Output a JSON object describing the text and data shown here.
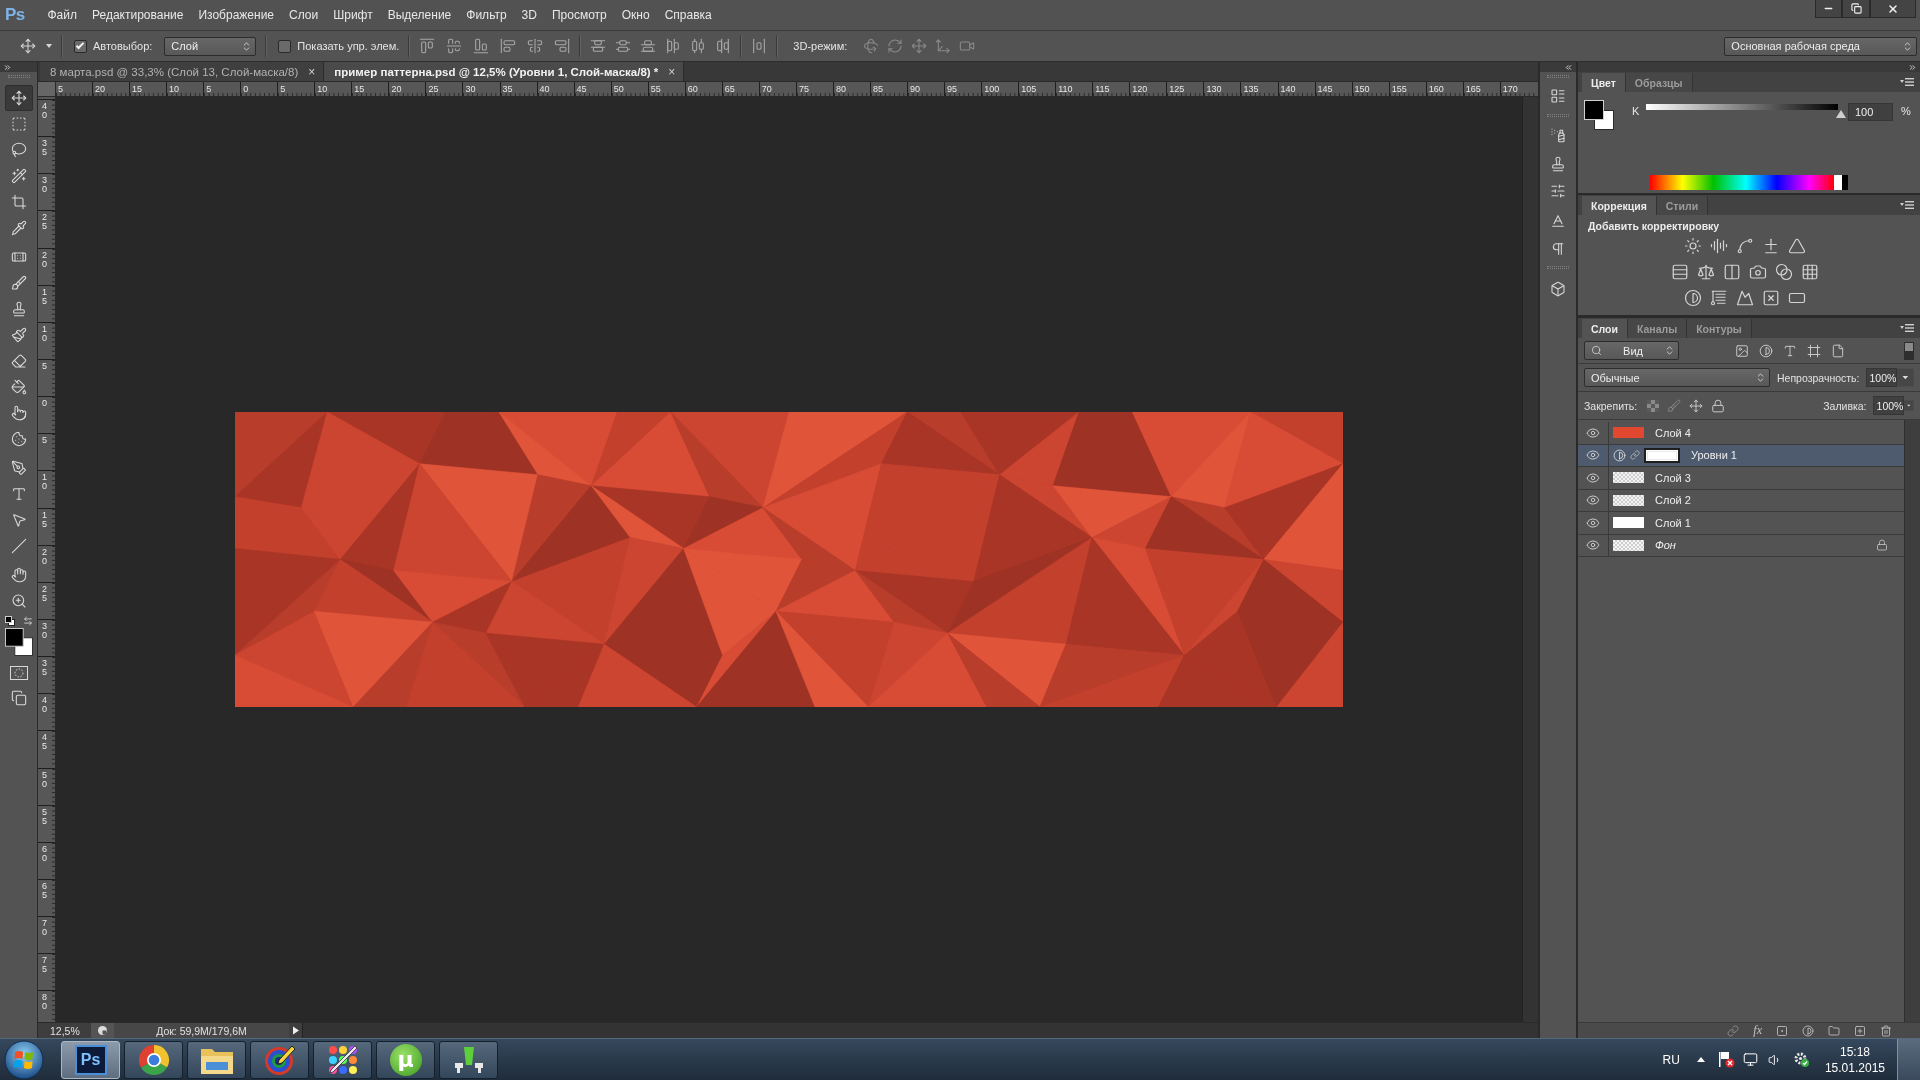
{
  "menu_bar": {
    "logo": "Ps",
    "items": [
      "Файл",
      "Редактирование",
      "Изображение",
      "Слои",
      "Шрифт",
      "Выделение",
      "Фильтр",
      "3D",
      "Просмотр",
      "Окно",
      "Справка"
    ]
  },
  "options_bar": {
    "auto_select": {
      "label": "Автовыбор:",
      "checked": true
    },
    "auto_select_target": "Слой",
    "show_transform": {
      "label": "Показать упр. элем.",
      "checked": false
    },
    "mode_3d_label": "3D-режим:",
    "workspace": "Основная рабочая среда"
  },
  "toolbar": {
    "tools": [
      {
        "kind": "move",
        "selected": true
      },
      {
        "kind": "marquee",
        "selected": false
      },
      {
        "kind": "lasso",
        "selected": false
      },
      {
        "kind": "wand",
        "selected": false
      },
      {
        "kind": "crop",
        "selected": false
      },
      {
        "kind": "eyedropper",
        "selected": false
      },
      {
        "kind": "healing",
        "selected": false
      },
      {
        "kind": "brush",
        "selected": false
      },
      {
        "kind": "stamp",
        "selected": false
      },
      {
        "kind": "history_brush",
        "selected": false
      },
      {
        "kind": "eraser",
        "selected": false
      },
      {
        "kind": "bucket",
        "selected": false
      },
      {
        "kind": "smudge",
        "selected": false
      },
      {
        "kind": "sponge",
        "selected": false
      },
      {
        "kind": "pen",
        "selected": false
      },
      {
        "kind": "type",
        "selected": false
      },
      {
        "kind": "path_select",
        "selected": false
      },
      {
        "kind": "line",
        "selected": false
      },
      {
        "kind": "hand",
        "selected": false
      },
      {
        "kind": "zoom",
        "selected": false
      }
    ]
  },
  "document_tabs": [
    {
      "title": "8 марта.psd @ 33,3% (Слой 13, Слой-маска/8)",
      "close": "×",
      "selected": false
    },
    {
      "title": "пример паттерна.psd @ 12,5% (Уровни 1, Слой-маска/8) *",
      "close": "×",
      "selected": true
    }
  ],
  "rulers": {
    "horizontal": [
      "5",
      "20",
      "15",
      "10",
      "5",
      "0",
      "5",
      "10",
      "15",
      "20",
      "25",
      "30",
      "35",
      "40",
      "45",
      "50",
      "55",
      "60",
      "65",
      "70",
      "75",
      "80",
      "85",
      "90",
      "95",
      "100",
      "105",
      "110",
      "115",
      "120",
      "125",
      "130",
      "135",
      "140",
      "145",
      "150",
      "155",
      "160",
      "165",
      "170"
    ],
    "vertical": [
      "40",
      "35",
      "30",
      "25",
      "20",
      "15",
      "10",
      "5",
      "0",
      "5",
      "10",
      "15",
      "20",
      "25",
      "30",
      "35",
      "40",
      "45",
      "50",
      "55",
      "60",
      "65",
      "70",
      "75",
      "80"
    ]
  },
  "status_bar": {
    "zoom": "12,5%",
    "doc_info": "Док: 59,9M/179,6M"
  },
  "color_panel": {
    "tabs": [
      {
        "label": "Цвет",
        "selected": true
      },
      {
        "label": "Образцы",
        "selected": false
      }
    ],
    "channel": {
      "name": "K",
      "level": 1,
      "reading": "100",
      "unit": "%"
    }
  },
  "adjustments_panel": {
    "tabs": [
      {
        "label": "Коррекция",
        "selected": true
      },
      {
        "label": "Стили",
        "selected": false
      }
    ],
    "heading": "Добавить корректировку"
  },
  "layers_panel": {
    "tabs": [
      {
        "label": "Слои",
        "selected": true
      },
      {
        "label": "Каналы",
        "selected": false
      },
      {
        "label": "Контуры",
        "selected": false
      }
    ],
    "filter": "Вид",
    "blend_mode": "Обычные",
    "opacity": {
      "label": "Непрозрачность:",
      "value": "100%"
    },
    "lock_label": "Закрепить:",
    "fill": {
      "label": "Заливка:",
      "value": "100%"
    },
    "layers": [
      {
        "name": "Слой 4",
        "kind": "solid",
        "color": "#e2472f",
        "visible": true,
        "selected": false,
        "locked": false
      },
      {
        "name": "Уровни 1",
        "kind": "adjustment",
        "visible": true,
        "selected": true,
        "locked": false
      },
      {
        "name": "Слой 3",
        "kind": "transparent",
        "visible": true,
        "selected": false,
        "locked": false
      },
      {
        "name": "Слой 2",
        "kind": "transparent",
        "visible": true,
        "selected": false,
        "locked": false
      },
      {
        "name": "Слой 1",
        "kind": "solid",
        "color": "#ffffff",
        "visible": true,
        "selected": false,
        "locked": false
      },
      {
        "name": "Фон",
        "kind": "transparent",
        "visible": true,
        "selected": false,
        "locked": true
      }
    ],
    "effects_label": "fx"
  },
  "taskbar": {
    "apps": [
      {
        "kind": "photoshop",
        "label": "Ps",
        "selected": true
      },
      {
        "kind": "browser",
        "selected": false
      },
      {
        "kind": "files",
        "selected": false
      },
      {
        "kind": "paint",
        "selected": false
      },
      {
        "kind": "palette",
        "selected": false
      },
      {
        "kind": "torrent",
        "label": "µ",
        "selected": false
      },
      {
        "kind": "meter",
        "selected": false
      }
    ],
    "language": "RU",
    "time": "15:18",
    "date": "15.01.2015"
  }
}
